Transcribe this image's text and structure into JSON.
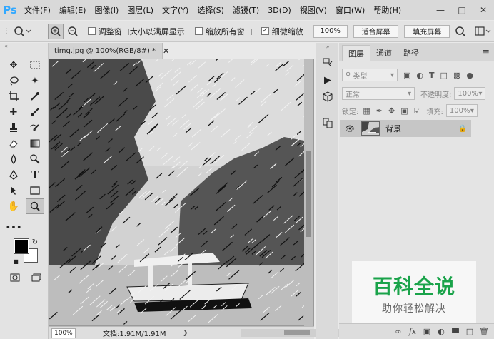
{
  "app": {
    "logo": "Ps",
    "menu": [
      "文件(F)",
      "编辑(E)",
      "图像(I)",
      "图层(L)",
      "文字(Y)",
      "选择(S)",
      "滤镜(T)",
      "3D(D)",
      "视图(V)",
      "窗口(W)",
      "帮助(H)"
    ],
    "window_controls": [
      "minimize-icon",
      "maximize-icon",
      "close-icon"
    ]
  },
  "options_bar": {
    "resize_windows_label": "调整窗口大小以满屏显示",
    "resize_windows_checked": false,
    "zoom_all_label": "缩放所有窗口",
    "zoom_all_checked": false,
    "scrubby_zoom_label": "细微缩放",
    "scrubby_zoom_checked": true,
    "zoom_value": "100%",
    "fit_screen_label": "适合屏幕",
    "fill_screen_label": "填充屏幕"
  },
  "document": {
    "tab_title": "timg.jpg @ 100%(RGB/8#) *",
    "status_zoom": "100%",
    "status_info": "文档:1.91M/1.91M"
  },
  "layers_panel": {
    "tabs": [
      "图层",
      "通道",
      "路径"
    ],
    "active_tab": 0,
    "filter_label": "类型",
    "blend_mode": "正常",
    "opacity_label": "不透明度:",
    "opacity_value": "100%",
    "lock_label": "锁定:",
    "fill_label": "填充:",
    "fill_value": "100%",
    "layers": [
      {
        "name": "背景",
        "visible": true,
        "locked": true
      }
    ]
  },
  "watermark": {
    "title": "百科全说",
    "subtitle": "助你轻松解决"
  },
  "colors": {
    "ps_blue": "#31a8ff",
    "watermark_green": "#1aa34a"
  }
}
